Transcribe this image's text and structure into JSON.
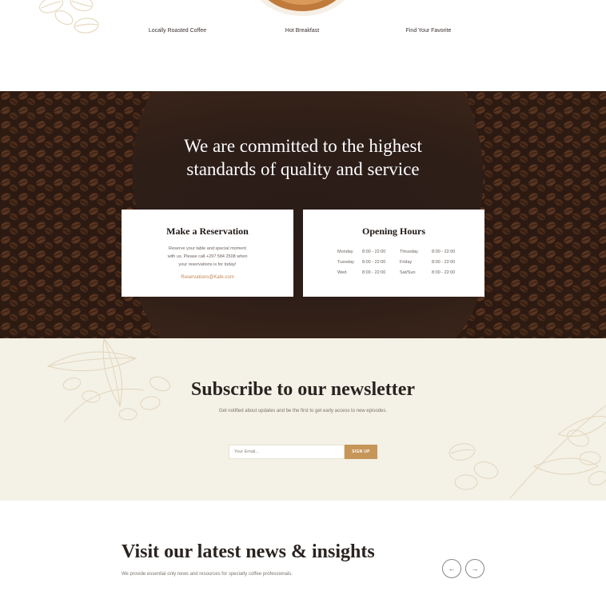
{
  "features": {
    "items": [
      {
        "label": "Locally Roasted Coffee"
      },
      {
        "label": "Hot Breakfast"
      },
      {
        "label": "Find Your Favorite"
      }
    ]
  },
  "commitment": {
    "heading_line1": "We are committed to the highest",
    "heading_line2": "standards of quality and service"
  },
  "reservation": {
    "title": "Make a Reservation",
    "text_line1": "Reserve your table and special moment",
    "text_line2": "with us. Please call +297 584 2508 when",
    "text_line3": "your reservations is for today!",
    "email": "Reservations@Kafe.com"
  },
  "hours": {
    "title": "Opening Hours",
    "rows": [
      {
        "day1": "Monday",
        "time1": "8:00 - 22:00",
        "day2": "Thrusday",
        "time2": "8:00 - 22:00"
      },
      {
        "day1": "Tuesday",
        "time1": "8:00 - 22:00",
        "day2": "Friday",
        "time2": "8:00 - 22:00"
      },
      {
        "day1": "Wed.",
        "time1": "8:00 - 22:00",
        "day2": "Sat/Sun",
        "time2": "8:00 - 22:00"
      }
    ]
  },
  "newsletter": {
    "title": "Subscribe to our newsletter",
    "subtitle": "Get notified about updates and be the first to get early access to new episodes.",
    "email_placeholder": "Your Email...",
    "button_label": "SIGN UP"
  },
  "news": {
    "title": "Visit our latest news & insights",
    "subtitle": "We provide essential only news and resources for specialty coffee professionals.",
    "prev_icon": "arrow-left-icon",
    "next_icon": "arrow-right-icon"
  },
  "colors": {
    "accent": "#c69659",
    "link": "#c38a54",
    "dark_bg": "#2a1c17",
    "cream_bg": "#f4f1e6"
  }
}
